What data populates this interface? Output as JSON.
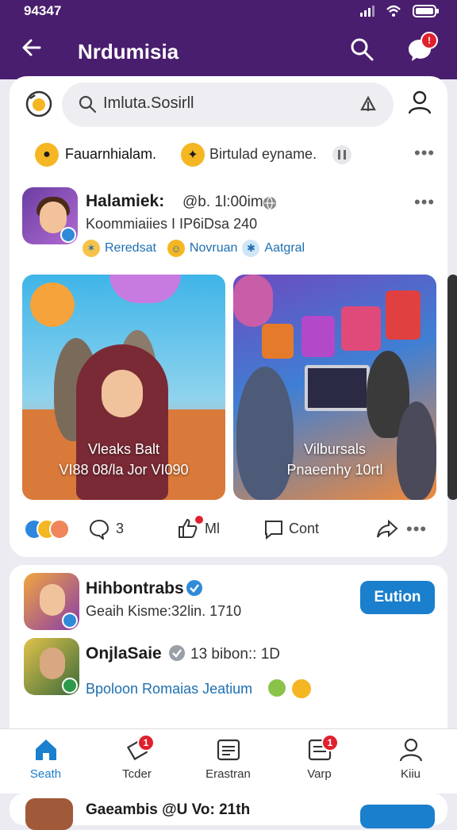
{
  "status": {
    "time": "94347"
  },
  "appbar": {
    "title": "Nrdumisia",
    "chat_badge": "!"
  },
  "search": {
    "value": "Imluta.Sosirll"
  },
  "stories": {
    "item1": "Fauarnhialam.",
    "item2": "Birtulad eyname."
  },
  "post": {
    "name": "Halamiek:",
    "meta": "@b. 1l:00ime",
    "subtitle": "Koommiaiies I IP6iDsa 240",
    "tags": [
      "Reredsat",
      "Novruan",
      "Aatgral"
    ],
    "tile1_caption_line1": "Vleaks Balt",
    "tile1_caption_line2": "VI88 08/la Jor VI090",
    "tile2_caption_line1": "Vilbursals",
    "tile2_caption_line2": "Pnaeenhy 10rtl",
    "comments": "3",
    "likes": "Ml",
    "share_label": "Cont"
  },
  "suggestions": [
    {
      "name": "Hihbontrabs",
      "sub": "Geaih Kisme:32lin. 1710",
      "button": "Eution"
    },
    {
      "name": "OnjlaSaie",
      "meta": "13  bibon:: 1D",
      "sub": "Bpoloon Romaias Jeatium"
    }
  ],
  "peek": {
    "name": "Gaeambis @U Vo: 21th"
  },
  "tabs": [
    {
      "label": "Seath",
      "icon": "home-icon"
    },
    {
      "label": "Tcder",
      "icon": "tag-icon",
      "badge": "1"
    },
    {
      "label": "Erastran",
      "icon": "news-icon"
    },
    {
      "label": "Varp",
      "icon": "inbox-icon",
      "badge": "1"
    },
    {
      "label": "Kiiu",
      "icon": "profile-icon"
    }
  ],
  "colors": {
    "brand": "#4a1e6e",
    "accent": "#1a7fcd",
    "badge": "#e0202e"
  }
}
